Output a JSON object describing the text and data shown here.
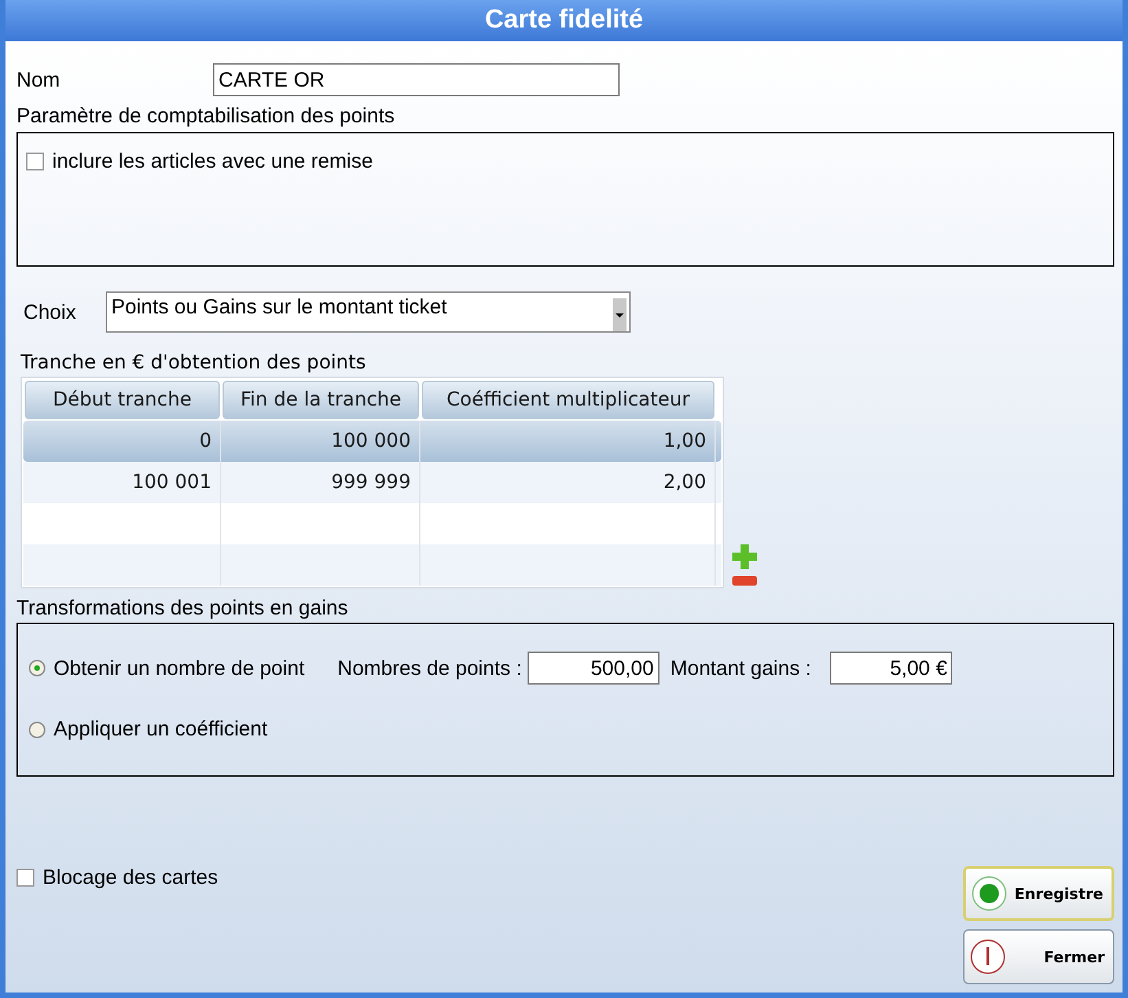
{
  "window": {
    "title": "Carte fidelité"
  },
  "name_field": {
    "label": "Nom",
    "value": "CARTE OR"
  },
  "points_settings": {
    "title": "Paramètre de comptabilisation des points",
    "options": [
      {
        "label": "inclure les articles avec une remise",
        "checked": false
      }
    ]
  },
  "choice": {
    "label": "Choix",
    "value": "Points ou Gains sur le montant ticket"
  },
  "brackets": {
    "title": "Tranche en € d'obtention des points",
    "columns": [
      "Début tranche",
      "Fin de la tranche",
      "Coéfficient multiplicateur"
    ],
    "rows": [
      {
        "cells": [
          "0",
          "100 000",
          "1,00"
        ],
        "selected": true
      },
      {
        "cells": [
          "100 001",
          "999 999",
          "2,00"
        ],
        "selected": false
      }
    ]
  },
  "transformations": {
    "title": "Transformations des points en gains",
    "options": [
      {
        "label": "Obtenir un nombre de point",
        "selected": true
      },
      {
        "label": "Appliquer un coéfficient",
        "selected": false
      }
    ],
    "points_label": "Nombres de points :",
    "points_value": "500,00",
    "gains_label": "Montant gains :",
    "gains_value": "5,00 €"
  },
  "buttons": [
    {
      "label": "Enregistre",
      "kind": "save"
    },
    {
      "label": "Fermer",
      "kind": "close"
    }
  ],
  "card_block": {
    "label": "Blocage des cartes",
    "checked": false
  }
}
